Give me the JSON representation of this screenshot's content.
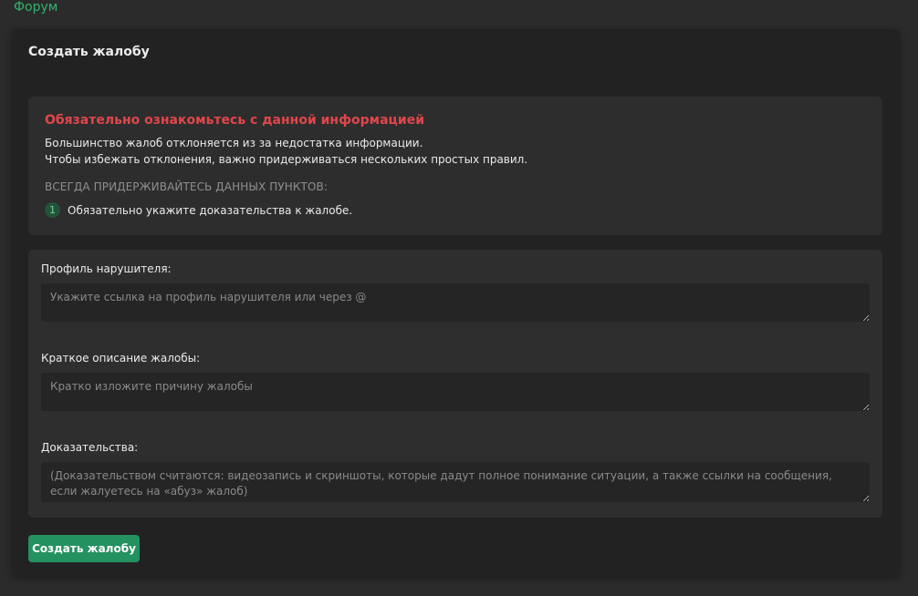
{
  "breadcrumb": {
    "label": "Форум"
  },
  "panel": {
    "title": "Создать жалобу"
  },
  "info": {
    "heading": "Обязательно ознакомьтесь с данной информацией",
    "lines": [
      "Большинство жалоб отклоняется из за недостатка информации.",
      "Чтобы избежать отклонения, важно придерживаться нескольких простых правил."
    ],
    "subheading": "ВСЕГДА ПРИДЕРЖИВАЙТЕСЬ ДАННЫХ ПУНКТОВ:",
    "rules": [
      {
        "number": "1",
        "text": "Обязательно укажите доказательства к жалобе."
      }
    ]
  },
  "form": {
    "fields": [
      {
        "label": "Профиль нарушителя:",
        "value": "",
        "placeholder": "Укажите ссылка на профиль нарушителя или через @"
      },
      {
        "label": "Краткое описание жалобы:",
        "value": "",
        "placeholder": "Кратко изложите причину жалобы"
      },
      {
        "label": "Доказательства:",
        "value": "",
        "placeholder": "(Доказательством считаются: видеозапись и скриншоты, которые дадут полное понимание ситуации, а также ссылки на сообщения, если жалуетесь на «абуз» жалоб)"
      }
    ],
    "submit_label": "Создать жалобу"
  },
  "colors": {
    "accent": "#249160",
    "link": "#2fb36b",
    "warning": "#e0464b",
    "background": "#2b2b2b",
    "panel": "#222222"
  }
}
